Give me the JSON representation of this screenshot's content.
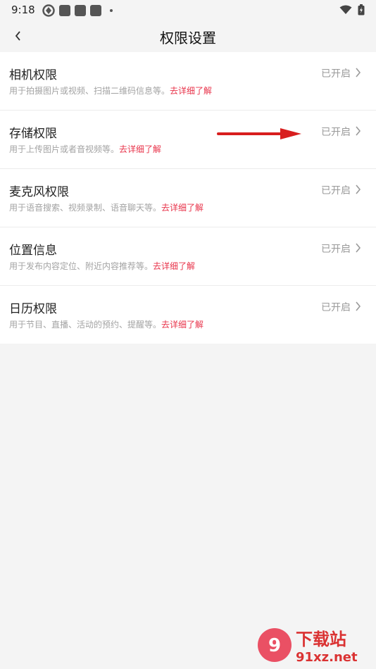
{
  "status_bar": {
    "time": "9:18"
  },
  "header": {
    "title": "权限设置"
  },
  "permissions": [
    {
      "title": "相机权限",
      "desc": "用于拍摄图片或视频、扫描二维码信息等。",
      "link": "去详细了解",
      "status": "已开启"
    },
    {
      "title": "存储权限",
      "desc": "用于上传图片或者音视频等。",
      "link": "去详细了解",
      "status": "已开启"
    },
    {
      "title": "麦克风权限",
      "desc": "用于语音搜索、视频录制、语音聊天等。",
      "link": "去详细了解",
      "status": "已开启"
    },
    {
      "title": "位置信息",
      "desc": "用于发布内容定位、附近内容推荐等。",
      "link": "去详细了解",
      "status": "已开启"
    },
    {
      "title": "日历权限",
      "desc": "用于节目、直播、活动的预约、提醒等。",
      "link": "去详细了解",
      "status": "已开启"
    }
  ],
  "watermark": {
    "cn": "下载站",
    "en": "91xz.net"
  },
  "colors": {
    "link": "#e8334a",
    "annotation_arrow": "#d81e1e",
    "background": "#f4f4f4"
  }
}
